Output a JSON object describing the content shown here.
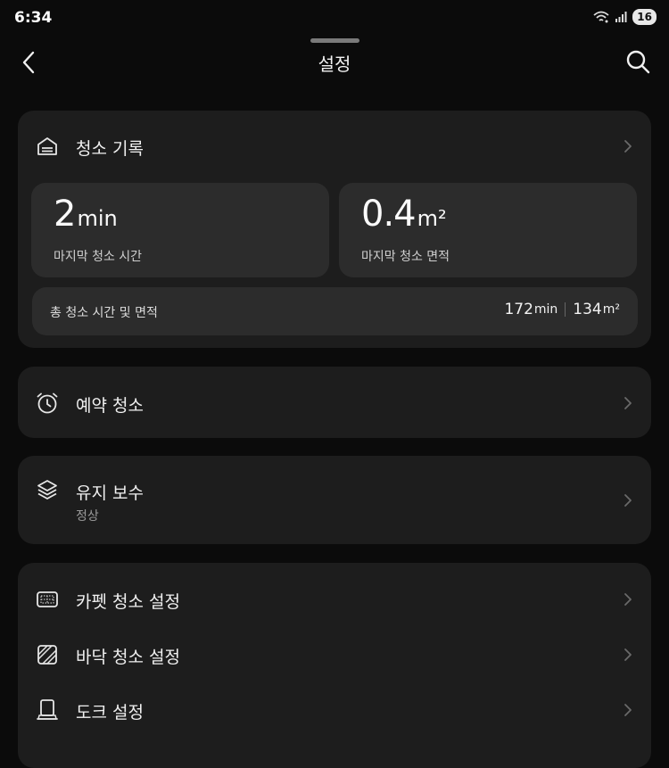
{
  "status": {
    "time": "6:34",
    "battery": "16"
  },
  "header": {
    "title": "설정"
  },
  "history": {
    "title": "청소 기록",
    "last_time": {
      "value": "2",
      "unit": "min",
      "label": "마지막 청소 시간"
    },
    "last_area": {
      "value": "0.4",
      "unit": "m²",
      "label": "마지막 청소 면적"
    },
    "total": {
      "label": "총 청소 시간 및 면적",
      "time_value": "172",
      "time_unit": "min",
      "area_value": "134",
      "area_unit": "m²"
    }
  },
  "schedule": {
    "label": "예약 청소"
  },
  "maintenance": {
    "label": "유지 보수",
    "status": "정상"
  },
  "settings": {
    "carpet": "카펫 청소 설정",
    "floor": "바닥 청소 설정",
    "dock": "도크 설정"
  }
}
